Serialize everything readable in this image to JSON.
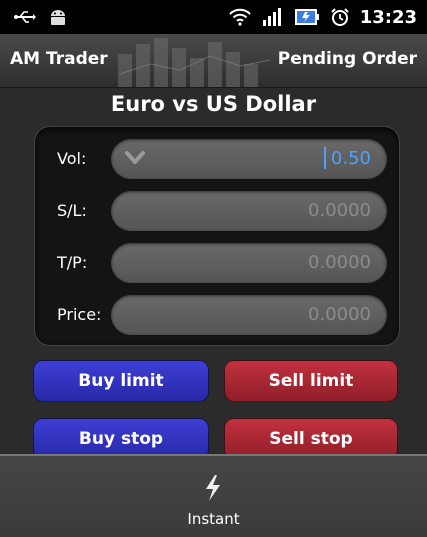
{
  "status_bar": {
    "time": "13:23",
    "icons": [
      "usb-icon",
      "android-icon",
      "wifi-icon",
      "signal-icon",
      "battery-icon",
      "alarm-icon"
    ]
  },
  "app_bar": {
    "app_title": "AM Trader",
    "mode_title": "Pending Order"
  },
  "pair_title": "Euro vs US Dollar",
  "form": {
    "vol": {
      "label": "Vol:",
      "value": "0.50"
    },
    "sl": {
      "label": "S/L:",
      "value": "0.0000"
    },
    "tp": {
      "label": "T/P:",
      "value": "0.0000"
    },
    "price": {
      "label": "Price:",
      "value": "0.0000"
    }
  },
  "buttons": {
    "buy_limit": "Buy limit",
    "sell_limit": "Sell limit",
    "buy_stop": "Buy stop",
    "sell_stop": "Sell stop"
  },
  "menu": {
    "instant_label": "Instant",
    "instant_icon": "lightning-icon"
  },
  "colors": {
    "buy": "#3334c4",
    "sell": "#b02837",
    "active_value": "#4fa0ff"
  }
}
